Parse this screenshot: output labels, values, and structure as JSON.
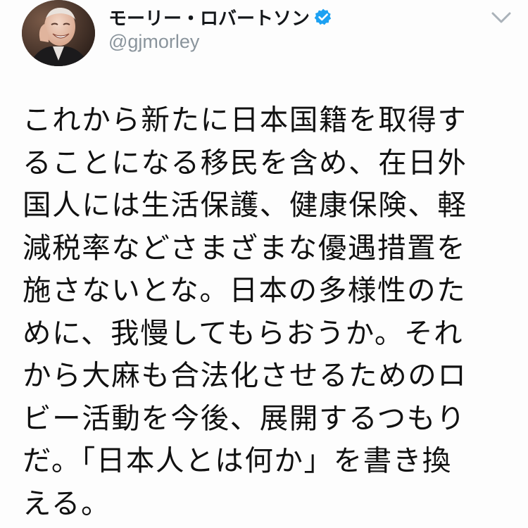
{
  "tweet": {
    "author": {
      "display_name": "モーリー・ロバートソン",
      "handle": "@gjmorley",
      "verified": true
    },
    "icons": {
      "avatar": "profile-photo",
      "verified": "verified-badge-icon",
      "menu": "chevron-down-icon"
    },
    "colors": {
      "verified_badge": "#1da1f2",
      "handle": "#8a949c",
      "menu_caret": "#aab2b9",
      "text": "#111111"
    },
    "body_lines": [
      "これから新たに日本国籍を取得す",
      "ることになる移民を含め、在日外",
      "国人には生活保護、健康保険、軽",
      "減税率などさまざまな優遇措置を",
      "施さないとな。日本の多様性のた",
      "めに、我慢してもらおうか。それ",
      "から大麻も合法化させるためのロ",
      "ビー活動を今後、展開するつもり",
      "だ。「日本人とは何か」を書き換",
      "える。"
    ]
  }
}
